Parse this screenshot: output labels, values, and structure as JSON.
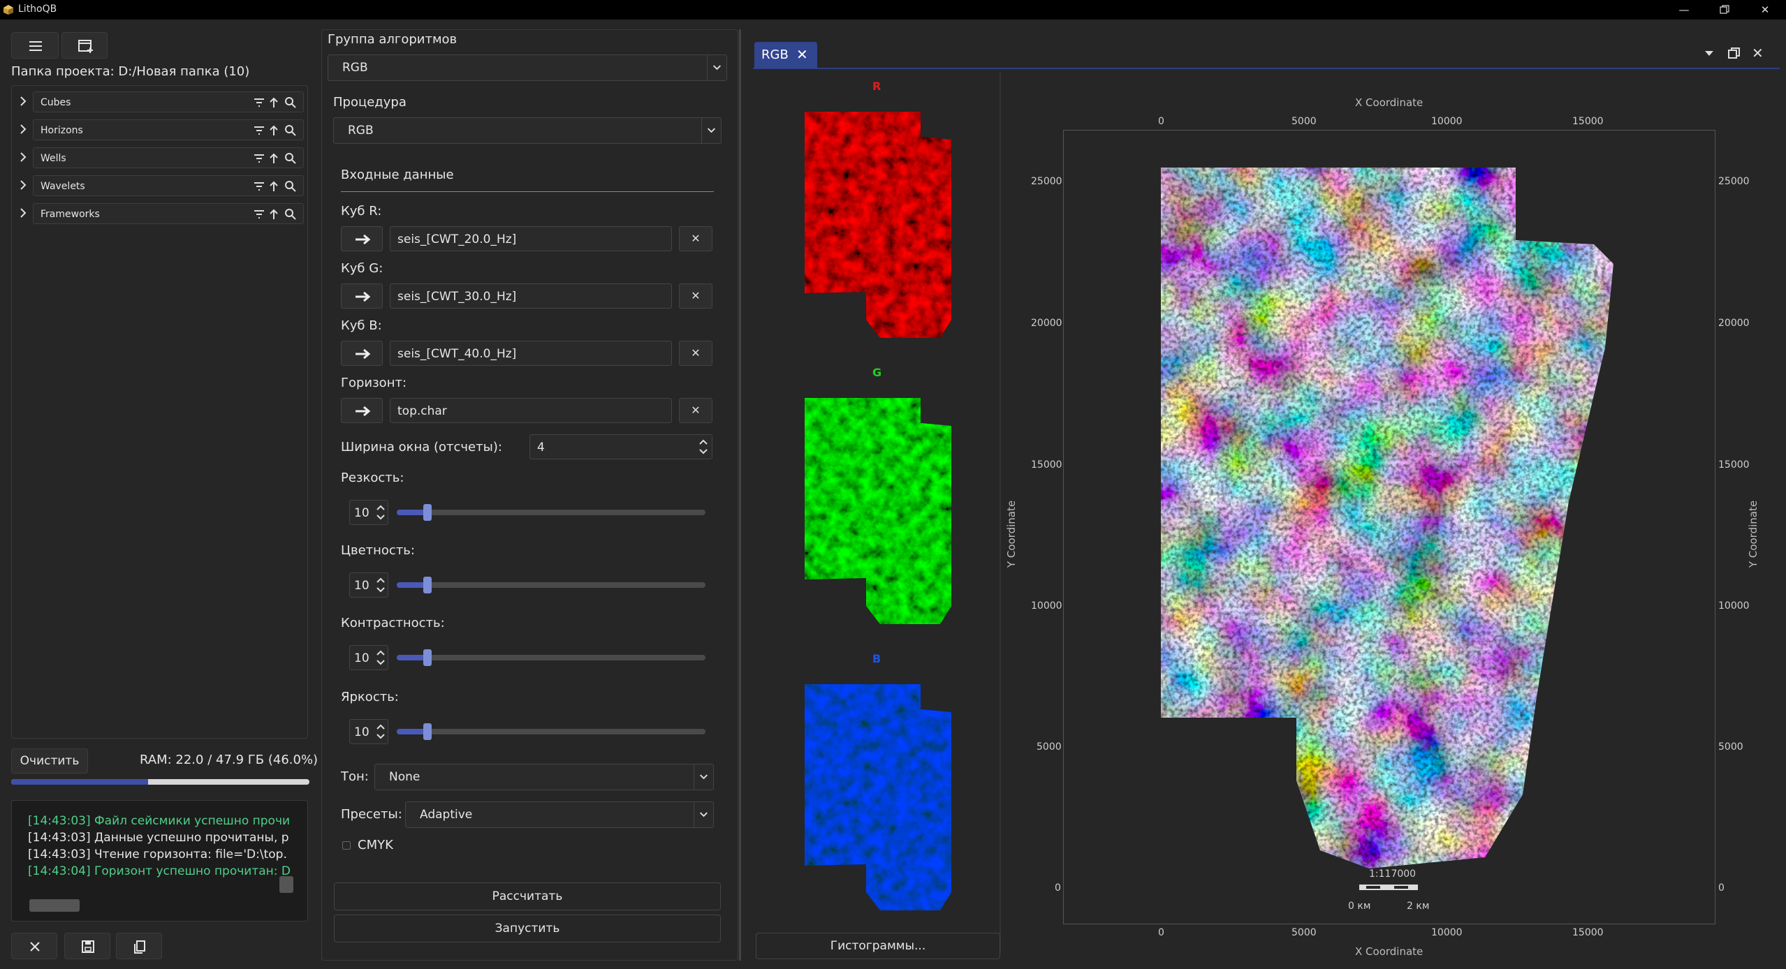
{
  "window": {
    "title": "LithoQB",
    "controls": [
      "minimize-icon",
      "restore-icon",
      "close-icon"
    ]
  },
  "left": {
    "project_folder": "Папка проекта: D:/Новая папка (10)",
    "tree_items": [
      {
        "label": "Cubes"
      },
      {
        "label": "Horizons"
      },
      {
        "label": "Wells"
      },
      {
        "label": "Wavelets"
      },
      {
        "label": "Frameworks"
      }
    ],
    "clear_label": "Очистить",
    "ram_label": "RAM: 22.0 / 47.9 ГБ (46.0%)",
    "ram_fraction": 0.46,
    "log": [
      {
        "text": "[14:43:03] Файл сейсмики успешно прочи",
        "color": "#4fd08a"
      },
      {
        "text": "[14:43:03] Данные успешно прочитаны, р",
        "color": "#e6e6e6"
      },
      {
        "text": "[14:43:03] Чтение горизонта: file='D:\\top.",
        "color": "#e6e6e6"
      },
      {
        "text": "[14:43:04] Горизонт успешно прочитан: D",
        "color": "#4fd08a"
      }
    ]
  },
  "middle": {
    "group_label": "Группа алгоритмов",
    "group_value": "RGB",
    "procedure_label": "Процедура",
    "procedure_value": "RGB",
    "input_header": "Входные данные",
    "cube_r_label": "Куб R:",
    "cube_r_value": "seis_[CWT_20.0_Hz]",
    "cube_g_label": "Куб G:",
    "cube_g_value": "seis_[CWT_30.0_Hz]",
    "cube_b_label": "Куб B:",
    "cube_b_value": "seis_[CWT_40.0_Hz]",
    "horizon_label": "Горизонт:",
    "horizon_value": "top.char",
    "window_width_label": "Ширина окна (отсчеты):",
    "window_width_value": "4",
    "sliders": [
      {
        "label": "Резкость:",
        "value": "10",
        "fraction": 0.1
      },
      {
        "label": "Цветность:",
        "value": "10",
        "fraction": 0.1
      },
      {
        "label": "Контрастность:",
        "value": "10",
        "fraction": 0.1
      },
      {
        "label": "Яркость:",
        "value": "10",
        "fraction": 0.1
      }
    ],
    "tone_label": "Тон:",
    "tone_value": "None",
    "presets_label": "Пресеты:",
    "presets_value": "Adaptive",
    "cmyk_label": "CMYK",
    "calc_label": "Рассчитать",
    "run_label": "Запустить"
  },
  "right": {
    "tab_label": "RGB",
    "thumb_r": "R",
    "thumb_g": "G",
    "thumb_b": "B",
    "hist_label": "Гистограммы...",
    "colors": {
      "r": "#e21c1c",
      "g": "#1fd11f",
      "b": "#1b56e6"
    }
  },
  "chart_data": {
    "type": "map",
    "x_axis_title": "X Coordinate",
    "y_axis_title": "Y Coordinate",
    "x_ticks": [
      "0",
      "5000",
      "10000",
      "15000"
    ],
    "y_ticks": [
      "25000",
      "20000",
      "15000",
      "10000",
      "5000",
      "0"
    ],
    "scale_label": "1:117000",
    "scale_start": "0 км",
    "scale_end": "2 км"
  }
}
